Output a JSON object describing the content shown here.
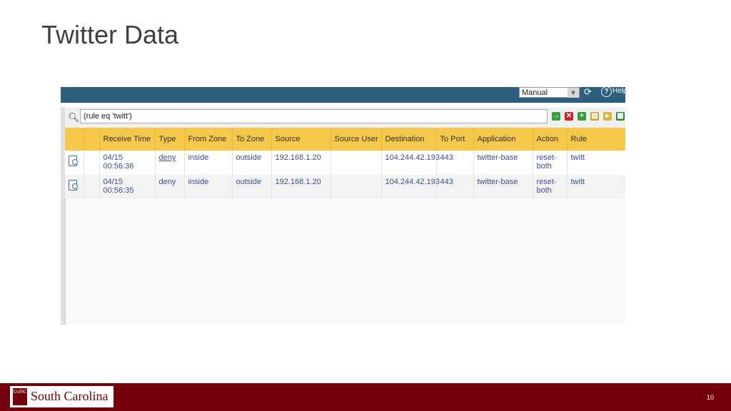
{
  "slide": {
    "title": "Twitter Data",
    "page_number": "10"
  },
  "screenshot": {
    "mode_select": "Manual",
    "help_label": "Help",
    "filter": "(rule eq 'twitt')",
    "columns": [
      "",
      "",
      "Receive Time",
      "Type",
      "From Zone",
      "To Zone",
      "Source",
      "Source User",
      "Destination",
      "To Port",
      "Application",
      "Action",
      "Rule"
    ],
    "rows": [
      {
        "receive_time": "04/15 00:56:36",
        "type": "deny",
        "from_zone": "inside",
        "to_zone": "outside",
        "source": "192.168.1.20",
        "source_user": "",
        "destination": "104.244.42.193",
        "to_port": "443",
        "application": "twitter-base",
        "action": "reset-both",
        "rule": "twitt"
      },
      {
        "receive_time": "04/15 00:56:35",
        "type": "deny",
        "from_zone": "inside",
        "to_zone": "outside",
        "source": "192.168.1.20",
        "source_user": "",
        "destination": "104.244.42.193",
        "to_port": "443",
        "application": "twitter-base",
        "action": "reset-both",
        "rule": "twitt"
      }
    ]
  },
  "footer": {
    "logo_mark": "UofSC",
    "logo_text": "South Carolina"
  },
  "colors": {
    "header_bar": "#2e5e7e",
    "column_header": "#f5c74a",
    "footer": "#73000a",
    "link_text": "#3d4f8c"
  }
}
